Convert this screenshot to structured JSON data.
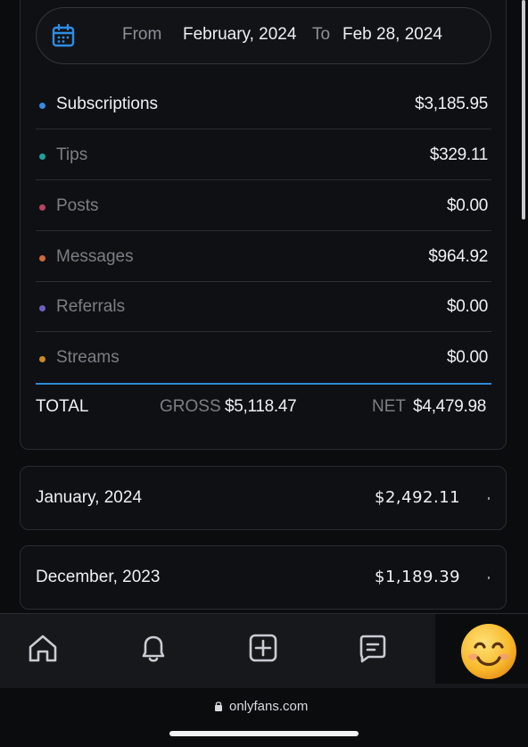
{
  "date_range": {
    "from_label": "From",
    "from_value": "February, 2024",
    "to_label": "To",
    "to_value": "Feb 28, 2024"
  },
  "earnings": [
    {
      "label": "Subscriptions",
      "amount": "$3,185.95",
      "dot_color": "#2f8de4",
      "active": true
    },
    {
      "label": "Tips",
      "amount": "$329.11",
      "dot_color": "#1aa39a",
      "active": false
    },
    {
      "label": "Posts",
      "amount": "$0.00",
      "dot_color": "#b84462",
      "active": false
    },
    {
      "label": "Messages",
      "amount": "$964.92",
      "dot_color": "#d06a3a",
      "active": false
    },
    {
      "label": "Referrals",
      "amount": "$0.00",
      "dot_color": "#6a5fc4",
      "active": false
    },
    {
      "label": "Streams",
      "amount": "$0.00",
      "dot_color": "#c98a22",
      "active": false
    }
  ],
  "total": {
    "label": "TOTAL",
    "gross_label": "GROSS",
    "gross_value": "$5,118.47",
    "net_label": "NET",
    "net_value": "$4,479.98"
  },
  "months": [
    {
      "label": "January, 2024",
      "amount": "$2,492.11"
    },
    {
      "label": "December, 2023",
      "amount": "$1,189.39"
    }
  ],
  "nav": {
    "icons": [
      "home-icon",
      "bell-icon",
      "plus-square-icon",
      "message-icon"
    ],
    "avatar": "smiley-face-emoji"
  },
  "browser": {
    "url": "onlyfans.com"
  },
  "colors": {
    "accent": "#2d8ad6",
    "background": "#0b0c0e"
  }
}
